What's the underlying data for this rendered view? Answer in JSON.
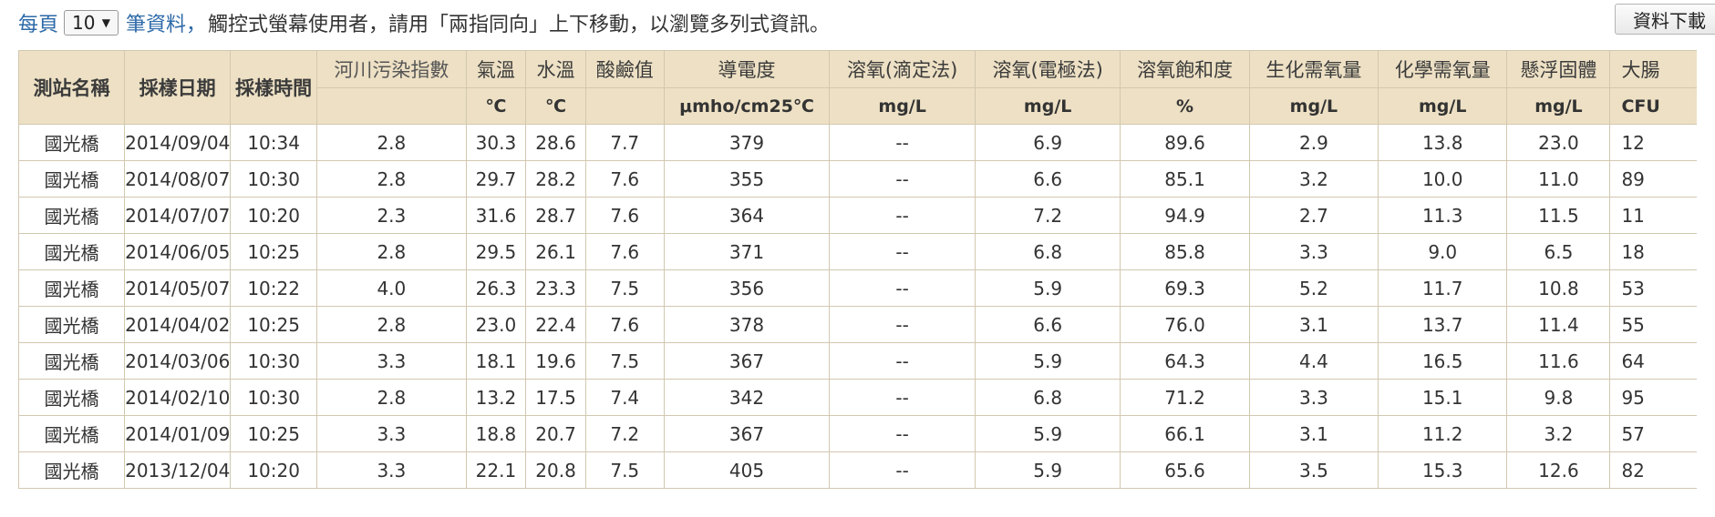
{
  "topbar": {
    "per_page_label": "每頁",
    "page_size": "10",
    "records_label": "筆資料，",
    "hint": "觸控式螢幕使用者，請用「兩指同向」上下移動，以瀏覽多列式資訊。"
  },
  "download_button": "資料下載",
  "table": {
    "headers": {
      "station": "測站名稱",
      "date": "採樣日期",
      "time": "採樣時間",
      "rpi": "河川污染指數",
      "air_temp": "氣溫",
      "water_temp": "水溫",
      "ph": "酸鹼值",
      "conductivity": "導電度",
      "do_titration": "溶氧(滴定法)",
      "do_electrode": "溶氧(電極法)",
      "do_saturation": "溶氧飽和度",
      "bod": "生化需氧量",
      "cod": "化學需氧量",
      "ss": "懸浮固體",
      "coliform": "大腸"
    },
    "units": {
      "air_temp": "℃",
      "water_temp": "℃",
      "conductivity": "μmho/cm25℃",
      "do_titration": "mg/L",
      "do_electrode": "mg/L",
      "do_saturation": "%",
      "bod": "mg/L",
      "cod": "mg/L",
      "ss": "mg/L",
      "coliform": "CFU"
    },
    "rows": [
      [
        "國光橋",
        "2014/09/04",
        "10:34",
        "2.8",
        "30.3",
        "28.6",
        "7.7",
        "379",
        "--",
        "6.9",
        "89.6",
        "2.9",
        "13.8",
        "23.0",
        "12"
      ],
      [
        "國光橋",
        "2014/08/07",
        "10:30",
        "2.8",
        "29.7",
        "28.2",
        "7.6",
        "355",
        "--",
        "6.6",
        "85.1",
        "3.2",
        "10.0",
        "11.0",
        "89"
      ],
      [
        "國光橋",
        "2014/07/07",
        "10:20",
        "2.3",
        "31.6",
        "28.7",
        "7.6",
        "364",
        "--",
        "7.2",
        "94.9",
        "2.7",
        "11.3",
        "11.5",
        "11"
      ],
      [
        "國光橋",
        "2014/06/05",
        "10:25",
        "2.8",
        "29.5",
        "26.1",
        "7.6",
        "371",
        "--",
        "6.8",
        "85.8",
        "3.3",
        "9.0",
        "6.5",
        "18"
      ],
      [
        "國光橋",
        "2014/05/07",
        "10:22",
        "4.0",
        "26.3",
        "23.3",
        "7.5",
        "356",
        "--",
        "5.9",
        "69.3",
        "5.2",
        "11.7",
        "10.8",
        "53"
      ],
      [
        "國光橋",
        "2014/04/02",
        "10:25",
        "2.8",
        "23.0",
        "22.4",
        "7.6",
        "378",
        "--",
        "6.6",
        "76.0",
        "3.1",
        "13.7",
        "11.4",
        "55"
      ],
      [
        "國光橋",
        "2014/03/06",
        "10:30",
        "3.3",
        "18.1",
        "19.6",
        "7.5",
        "367",
        "--",
        "5.9",
        "64.3",
        "4.4",
        "16.5",
        "11.6",
        "64"
      ],
      [
        "國光橋",
        "2014/02/10",
        "10:30",
        "2.8",
        "13.2",
        "17.5",
        "7.4",
        "342",
        "--",
        "6.8",
        "71.2",
        "3.3",
        "15.1",
        "9.8",
        "95"
      ],
      [
        "國光橋",
        "2014/01/09",
        "10:25",
        "3.3",
        "18.8",
        "20.7",
        "7.2",
        "367",
        "--",
        "5.9",
        "66.1",
        "3.1",
        "11.2",
        "3.2",
        "57"
      ],
      [
        "國光橋",
        "2013/12/04",
        "10:20",
        "3.3",
        "22.1",
        "20.8",
        "7.5",
        "405",
        "--",
        "5.9",
        "65.6",
        "3.5",
        "15.3",
        "12.6",
        "82"
      ]
    ]
  }
}
